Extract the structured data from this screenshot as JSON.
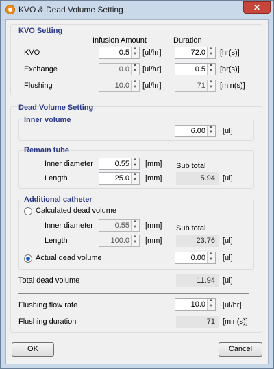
{
  "window": {
    "title": "KVO & Dead Volume Setting",
    "close_label": "✕"
  },
  "kvo": {
    "title": "KVO Setting",
    "col_infusion": "Infusion Amount",
    "col_duration": "Duration",
    "rows": [
      {
        "label": "KVO",
        "infusion": "0.5",
        "infusion_unit": "[ul/hr]",
        "duration": "72.0",
        "duration_unit": "[hr(s)]"
      },
      {
        "label": "Exchange",
        "infusion": "0.0",
        "infusion_unit": "[ul/hr]",
        "duration": "0.5",
        "duration_unit": "[hr(s)]"
      },
      {
        "label": "Flushing",
        "infusion": "10.0",
        "infusion_unit": "[ul/hr]",
        "duration": "71",
        "duration_unit": "[min(s)]"
      }
    ]
  },
  "dead": {
    "title": "Dead Volume Setting",
    "inner": {
      "title": "Inner volume",
      "value": "6.00",
      "unit": "[ul]"
    },
    "remain": {
      "title": "Remain tube",
      "diameter_label": "Inner diameter",
      "diameter": "0.55",
      "diameter_unit": "[mm]",
      "length_label": "Length",
      "length": "25.0",
      "length_unit": "[mm]",
      "subtotal_label": "Sub total",
      "subtotal": "5.94",
      "subtotal_unit": "[ul]"
    },
    "additional": {
      "title": "Additional catheter",
      "calc_label": "Calculated dead volume",
      "diameter_label": "Inner diameter",
      "diameter": "0.55",
      "diameter_unit": "[mm]",
      "length_label": "Length",
      "length": "100.0",
      "length_unit": "[mm]",
      "subtotal_label": "Sub total",
      "subtotal": "23.76",
      "subtotal_unit": "[ul]",
      "actual_label": "Actual dead volume",
      "actual": "0.00",
      "actual_unit": "[ul]"
    },
    "total_label": "Total dead volume",
    "total": "11.94",
    "total_unit": "[ul]",
    "flush_rate_label": "Flushing flow rate",
    "flush_rate": "10.0",
    "flush_rate_unit": "[ul/hr]",
    "flush_dur_label": "Flushing duration",
    "flush_dur": "71",
    "flush_dur_unit": "[min(s)]"
  },
  "buttons": {
    "ok": "OK",
    "cancel": "Cancel"
  },
  "colors": {
    "group_title": "#2b3a8a",
    "radio_selected": "#1f5fbf"
  }
}
